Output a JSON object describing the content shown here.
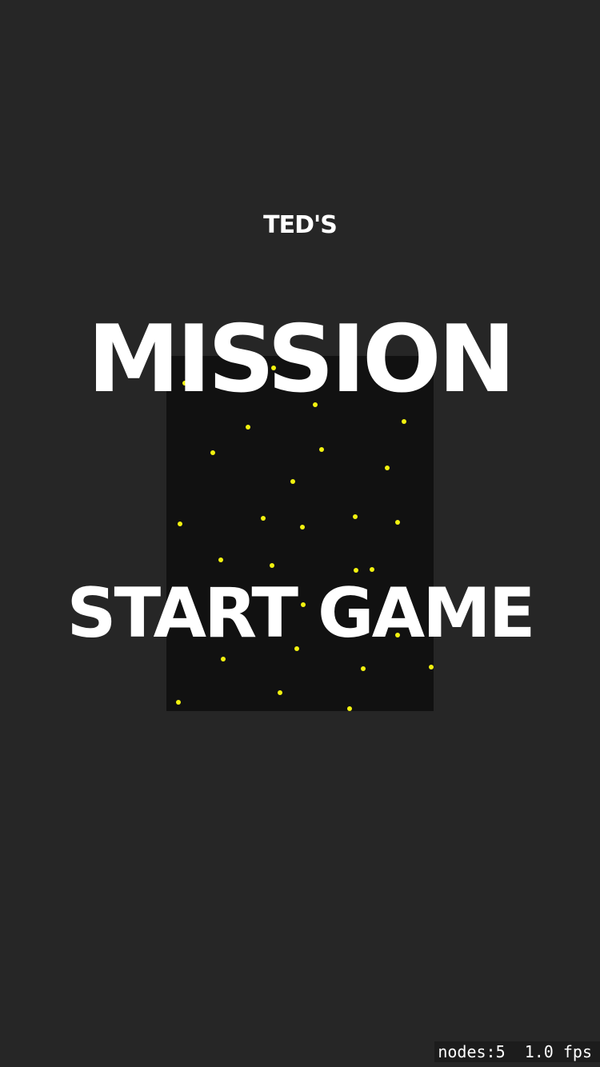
{
  "game": {
    "subtitle": "TED'S",
    "title": "MISSION",
    "start_label": "START GAME"
  },
  "debug": {
    "stats": "nodes:5  1.0 fps"
  },
  "colors": {
    "background": "#262626",
    "starfield": "#111111",
    "star": "#f2f20f",
    "text": "#ffffff"
  }
}
